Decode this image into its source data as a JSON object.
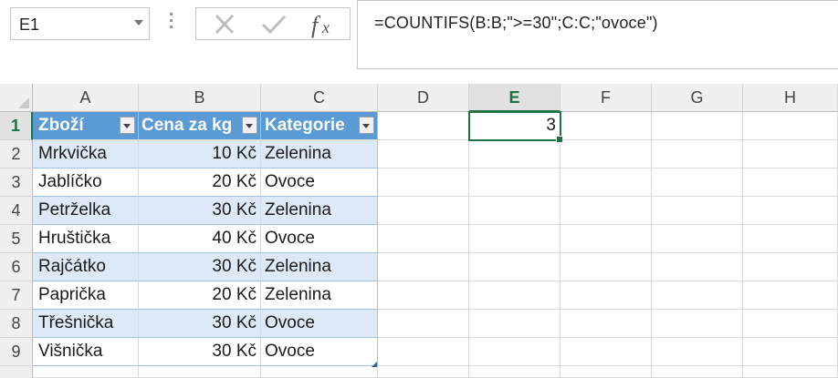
{
  "name_box": {
    "value": "E1"
  },
  "formula_bar": {
    "formula": "=COUNTIFS(B:B;\">=30\";C:C;\"ovoce\")"
  },
  "columns": [
    "A",
    "B",
    "C",
    "D",
    "E",
    "F",
    "G",
    "H"
  ],
  "rows": [
    "1",
    "2",
    "3",
    "4",
    "5",
    "6",
    "7",
    "8",
    "9"
  ],
  "table": {
    "headers": [
      "Zboží",
      "Cena za kg",
      "Kategorie"
    ],
    "rows": [
      [
        "Mrkvička",
        "10 Kč",
        "Zelenina"
      ],
      [
        "Jablíčko",
        "20 Kč",
        "Ovoce"
      ],
      [
        "Petrželka",
        "30 Kč",
        "Zelenina"
      ],
      [
        "Hruštička",
        "40 Kč",
        "Ovoce"
      ],
      [
        "Rajčátko",
        "30 Kč",
        "Zelenina"
      ],
      [
        "Paprička",
        "20 Kč",
        "Zelenina"
      ],
      [
        "Třešnička",
        "30 Kč",
        "Ovoce"
      ],
      [
        "Višnička",
        "30 Kč",
        "Ovoce"
      ]
    ]
  },
  "result_cell": {
    "address": "E1",
    "value": "3"
  },
  "colors": {
    "accent": "#217346",
    "table_header": "#5b9bd5",
    "table_band": "#dde9f6"
  }
}
